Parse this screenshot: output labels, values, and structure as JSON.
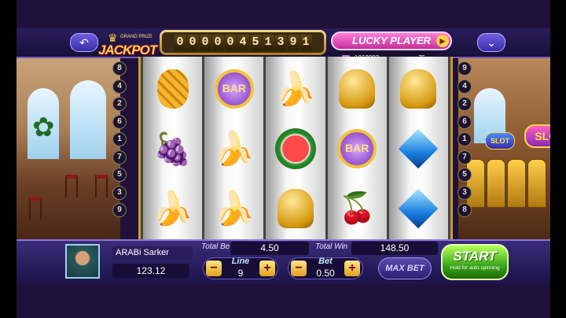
{
  "header": {
    "back_icon": "back-arrow-icon",
    "menu_icon": "chevron-down-icon",
    "jackpot_word": "JACKPOT",
    "jackpot_small": "GRAND PRIZE",
    "jackpot_digits": [
      "0",
      "0",
      "0",
      "0",
      "0",
      "4",
      "5",
      "1",
      "3",
      "9",
      "1"
    ],
    "lucky_label": "LUCKY PLAYER",
    "lucky_id": "1062883",
    "lucky_count": "75"
  },
  "lines_left": [
    "8",
    "4",
    "2",
    "6",
    "1",
    "7",
    "5",
    "3",
    "9"
  ],
  "lines_right": [
    "9",
    "4",
    "2",
    "6",
    "1",
    "7",
    "5",
    "3",
    "8"
  ],
  "reels": [
    [
      "pineapple",
      "grape",
      "banana"
    ],
    [
      "bar",
      "banana",
      "banana"
    ],
    [
      "banana",
      "watermelon",
      "bell"
    ],
    [
      "bell",
      "bar",
      "cherry"
    ],
    [
      "bell",
      "diamond",
      "diamond"
    ]
  ],
  "symbol_text": {
    "bar": "BAR"
  },
  "scene": {
    "slot_sign": "SLOT",
    "slot_sign_small": "SLOT"
  },
  "player": {
    "name": "ARABi Sarker",
    "balance": "123.12"
  },
  "bets": {
    "total_bet_label": "Total Bet",
    "total_bet_value": "4.50",
    "total_win_label": "Total Win",
    "total_win_value": "148.50",
    "line_label": "Line",
    "line_value": "9",
    "bet_label": "Bet",
    "bet_value": "0.50",
    "minus": "−",
    "plus": "+",
    "max_bet": "MAX BET",
    "start": "START",
    "start_hint": "Hold for auto spinning"
  }
}
